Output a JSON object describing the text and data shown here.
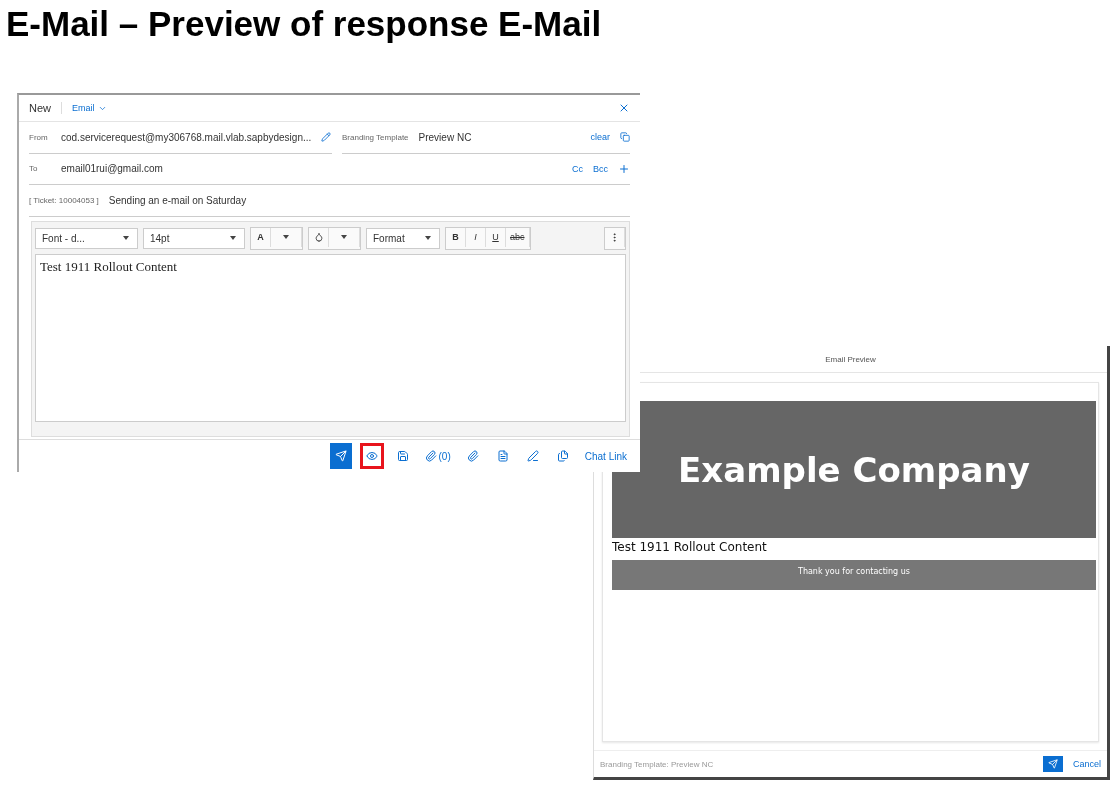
{
  "slide_title": "E-Mail – Preview of response E-Mail",
  "composer": {
    "header": {
      "title": "New",
      "type_label": "Email"
    },
    "from": {
      "label": "From",
      "value": "cod.servicerequest@my306768.mail.vlab.sapbydesign...",
      "branding_label": "Branding Template",
      "branding_value": "Preview NC",
      "clear": "clear"
    },
    "to": {
      "label": "To",
      "value": "email01rui@gmail.com",
      "cc": "Cc",
      "bcc": "Bcc"
    },
    "subject": {
      "ticket": "[ Ticket: 10004053 ]",
      "value": "Sending an e-mail on Saturday"
    },
    "toolbar": {
      "font": "Font - d...",
      "size": "14pt",
      "text_color": "A",
      "format": "Format",
      "styles": [
        "B",
        "I",
        "U",
        "abc"
      ]
    },
    "body": "Test 1911 Rollout Content",
    "actions": [
      {
        "kind": "send",
        "highlighted": false
      },
      {
        "kind": "preview",
        "highlighted": true
      },
      {
        "kind": "save",
        "highlighted": false
      },
      {
        "kind": "attach",
        "label": "(0)",
        "highlighted": false
      },
      {
        "kind": "attach-add",
        "highlighted": false
      },
      {
        "kind": "template",
        "highlighted": false
      },
      {
        "kind": "signature",
        "highlighted": false
      },
      {
        "kind": "copy",
        "highlighted": false
      },
      {
        "kind": "chat",
        "label": "Chat Link",
        "highlighted": false
      }
    ]
  },
  "preview": {
    "title": "Email Preview",
    "banner": "Example Company",
    "content": "Test 1911 Rollout Content",
    "footer_band": "Thank you for contacting us",
    "status": "Branding Template: Preview NC",
    "cancel": "Cancel"
  }
}
